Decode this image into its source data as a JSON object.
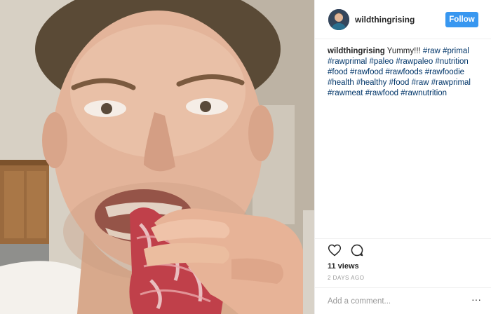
{
  "header": {
    "username": "wildthingrising",
    "follow_label": "Follow"
  },
  "caption": {
    "username": "wildthingrising",
    "text": "Yummy!!!",
    "hashtags": [
      "#raw",
      "#primal",
      "#rawprimal",
      "#paleo",
      "#rawpaleo",
      "#nutrition",
      "#food",
      "#rawfood",
      "#rawfoods",
      "#rawfoodie",
      "#health",
      "#healthy",
      "#food",
      "#raw",
      "#rawprimal",
      "#rawmeat",
      "#rawfood",
      "#rawnutrition"
    ]
  },
  "stats": {
    "views": "11 views",
    "time": "2 DAYS AGO"
  },
  "comment": {
    "placeholder": "Add a comment...",
    "more_label": "···"
  },
  "icons": {
    "like": "heart-icon",
    "comment": "comment-icon",
    "more": "more-options-icon"
  },
  "colors": {
    "follow_button": "#3897f0",
    "hashtag": "#003569",
    "muted": "#999999",
    "divider": "#efefef"
  }
}
